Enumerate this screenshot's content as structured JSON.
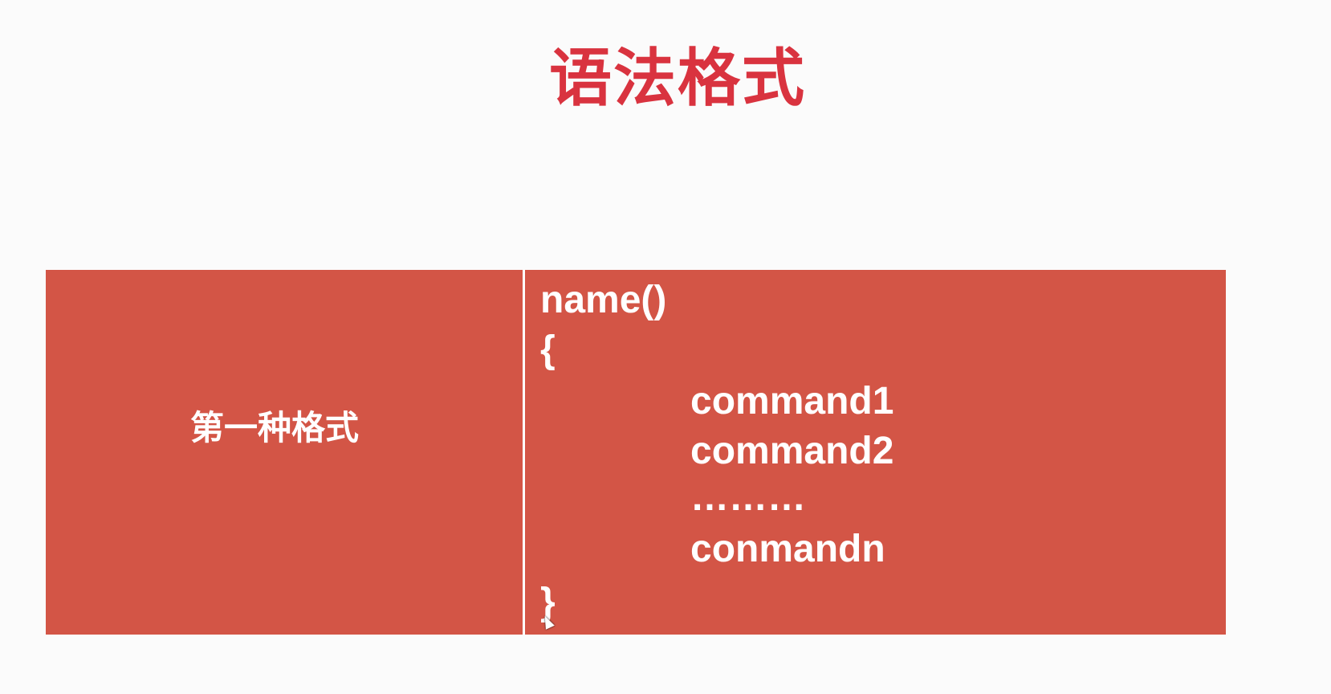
{
  "slide": {
    "title": "语法格式"
  },
  "table": {
    "format_label": "第一种格式",
    "code_lines": [
      "name()",
      "{",
      "command1",
      "command2",
      "………",
      "conmandn",
      "}"
    ]
  },
  "colors": {
    "title": "#d9333f",
    "cell_background": "#d35546",
    "text_on_cell": "#ffffff",
    "page_background": "#fbfbfb"
  },
  "icons": [
    "cursor-icon"
  ]
}
